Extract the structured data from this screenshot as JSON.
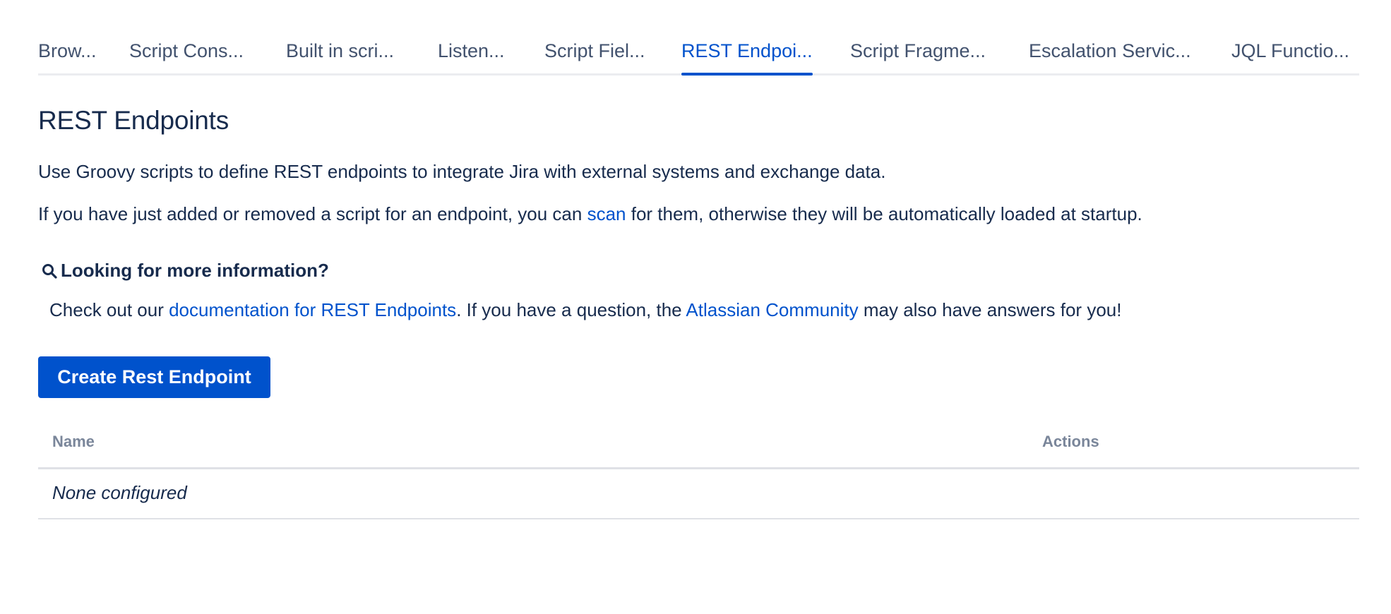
{
  "tabs": [
    {
      "label": "Brow...",
      "active": false
    },
    {
      "label": "Script Cons...",
      "active": false
    },
    {
      "label": "Built in scri...",
      "active": false
    },
    {
      "label": "Listen...",
      "active": false
    },
    {
      "label": "Script Fiel...",
      "active": false
    },
    {
      "label": "REST Endpoi...",
      "active": true
    },
    {
      "label": "Script Fragme...",
      "active": false
    },
    {
      "label": "Escalation Servic...",
      "active": false
    },
    {
      "label": "JQL Functio...",
      "active": false
    }
  ],
  "main": {
    "title": "REST Endpoints",
    "description": "Use Groovy scripts to define REST endpoints to integrate Jira with external systems and exchange data.",
    "scan_before": "If you have just added or removed a script for an endpoint, you can ",
    "scan_link": "scan",
    "scan_after": " for them, otherwise they will be automatically loaded at startup."
  },
  "info": {
    "icon": "search-icon",
    "heading": "Looking for more information?",
    "text_before": "Check out our ",
    "docs_link": "documentation for REST Endpoints",
    "text_middle": ". If you have a question, the ",
    "community_link": "Atlassian Community",
    "text_after": " may also have answers for you!"
  },
  "create_button": "Create Rest Endpoint",
  "table": {
    "columns": [
      "Name",
      "Actions"
    ],
    "empty_text": "None configured"
  },
  "colors": {
    "primary": "#0052cc",
    "text": "#172b4d",
    "tab_text": "#42526e",
    "header_text": "#7a869a"
  }
}
